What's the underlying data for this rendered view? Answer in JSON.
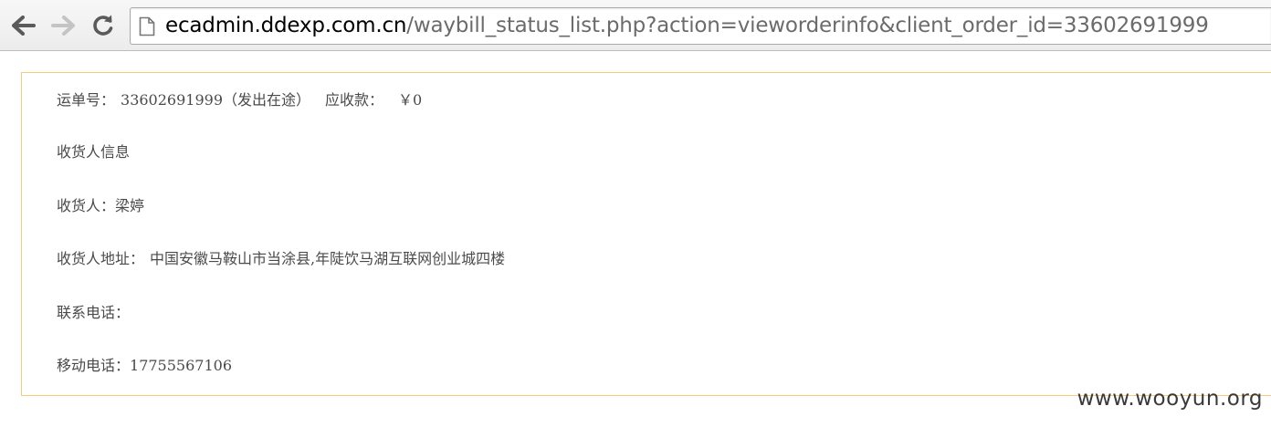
{
  "browser": {
    "back_icon": "back-arrow-icon",
    "forward_icon": "forward-arrow-icon",
    "reload_icon": "reload-icon",
    "page_icon": "page-document-icon",
    "url_host": "ecadmin.ddexp.com.cn",
    "url_path": "/waybill_status_list.php?action=vieworderinfo&client_order_id=33602691999"
  },
  "waybill": {
    "number_label": "运单号：",
    "number_value": "33602691999（发出在途）",
    "receivable_label": "应收款：",
    "receivable_value": "￥0"
  },
  "consignee": {
    "section_title": "收货人信息",
    "name_label": "收货人：",
    "name_value": "梁婷",
    "address_label": "收货人地址：",
    "address_value": "中国安徽马鞍山市当涂县,年陡饮马湖互联网创业城四楼",
    "phone_label": "联系电话：",
    "phone_value": "",
    "mobile_label": "移动电话：",
    "mobile_value": "17755567106"
  },
  "watermark": "www.wooyun.org",
  "colors": {
    "box_border": "#f5cc7a",
    "text": "#4a4a4a",
    "url_path": "#6b6b6b"
  }
}
